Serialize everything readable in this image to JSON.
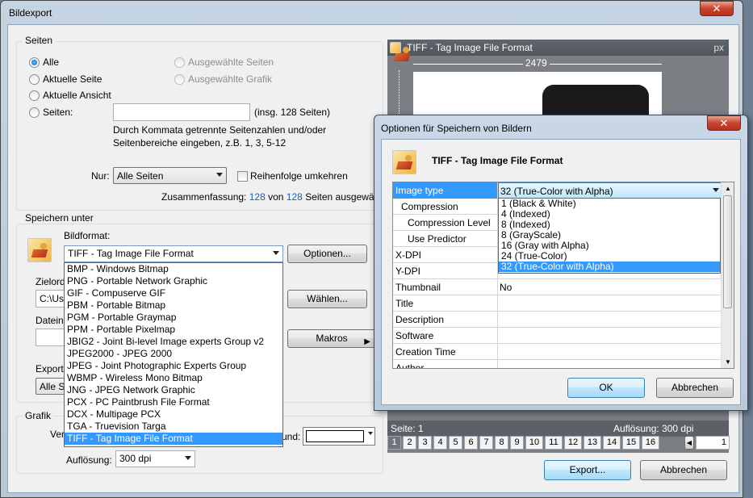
{
  "window": {
    "title": "Bildexport",
    "close_label": "✕"
  },
  "pages_group": {
    "title": "Seiten",
    "radio_all": "Alle",
    "radio_current_page": "Aktuelle Seite",
    "radio_current_view": "Aktuelle Ansicht",
    "radio_pages": "Seiten:",
    "radio_selected_pages": "Ausgewählte Seiten",
    "radio_selected_graphic": "Ausgewählte Grafik",
    "pages_input_value": "",
    "total_pages_note": "(insg. 128 Seiten)",
    "hint_line1": "Durch Kommata getrennte Seitenzahlen und/oder",
    "hint_line2": "Seitenbereiche eingeben, z.B. 1, 3, 5-12",
    "only_label": "Nur:",
    "only_value": "Alle Seiten",
    "reverse_label": "Reihenfolge umkehren",
    "summary_prefix": "Zusammenfassung:",
    "summary_count": "128",
    "summary_mid": "von",
    "summary_total": "128",
    "summary_suffix": "Seiten ausgewählt"
  },
  "save_group": {
    "title": "Speichern unter",
    "format_label": "Bildformat:",
    "format_value": "TIFF - Tag Image File Format",
    "options_button": "Optionen...",
    "target_label": "Zielord",
    "target_value": "C:\\Us",
    "choose_button": "Wählen...",
    "filename_label": "Dateina",
    "macros_button": "Makros",
    "export_label": "Exporta",
    "export_value": "Alle Se",
    "format_options": [
      "BMP - Windows Bitmap",
      "PNG - Portable Network Graphic",
      "GIF - Compuserve GIF",
      "PBM - Portable Bitmap",
      "PGM - Portable Graymap",
      "PPM - Portable Pixelmap",
      "JBIG2 - Joint Bi-level Image experts Group v2",
      "JPEG2000 - JPEG 2000",
      "JPEG - Joint Photographic Experts Group",
      "WBMP - Wireless Mono Bitmap",
      "JNG - JPEG Network Graphic",
      "PCX - PC Paintbrush File Format",
      "DCX - Multipage PCX",
      "TGA - Truevision Targa",
      "TIFF - Tag Image File Format"
    ]
  },
  "graphic_group": {
    "title": "Grafik",
    "ver_label": "Ver",
    "background_label": "und:",
    "resolution_label": "Auflösung:",
    "resolution_value": "300 dpi"
  },
  "preview": {
    "title": "TIFF - Tag Image File Format",
    "unit": "px",
    "width_value": "2479",
    "page_label": "Seite: 1",
    "resolution_label": "Auflösung: 300 dpi",
    "page_tabs": [
      "1",
      "2",
      "3",
      "4",
      "5",
      "6",
      "7",
      "8",
      "9",
      "10",
      "11",
      "12",
      "13",
      "14",
      "15",
      "16"
    ],
    "page_input": "1"
  },
  "footer": {
    "export_button": "Export...",
    "cancel_button": "Abbrechen"
  },
  "options_dialog": {
    "title": "Optionen für Speichern von Bildern",
    "format_title": "TIFF - Tag Image File Format",
    "rows": [
      {
        "name": "Image type",
        "value": "32 (True-Color with Alpha)"
      },
      {
        "name": "Compression",
        "value": ""
      },
      {
        "name": "Compression Level",
        "value": ""
      },
      {
        "name": "Use Predictor",
        "value": ""
      },
      {
        "name": "X-DPI",
        "value": ""
      },
      {
        "name": "Y-DPI",
        "value": ""
      },
      {
        "name": "Thumbnail",
        "value": "No"
      },
      {
        "name": "Title",
        "value": ""
      },
      {
        "name": "Description",
        "value": ""
      },
      {
        "name": "Software",
        "value": ""
      },
      {
        "name": "Creation Time",
        "value": ""
      },
      {
        "name": "Author",
        "value": ""
      }
    ],
    "image_type_options": [
      "1 (Black & White)",
      "4 (Indexed)",
      "8 (Indexed)",
      "8 (GrayScale)",
      "16 (Gray with Alpha)",
      "24 (True-Color)",
      "32 (True-Color with Alpha)"
    ],
    "ok_button": "OK",
    "cancel_button": "Abbrechen",
    "close_label": "✕"
  },
  "colors": {
    "selection": "#3399ff",
    "link_blue": "#1a5fb4",
    "close_red": "#c7452f"
  }
}
